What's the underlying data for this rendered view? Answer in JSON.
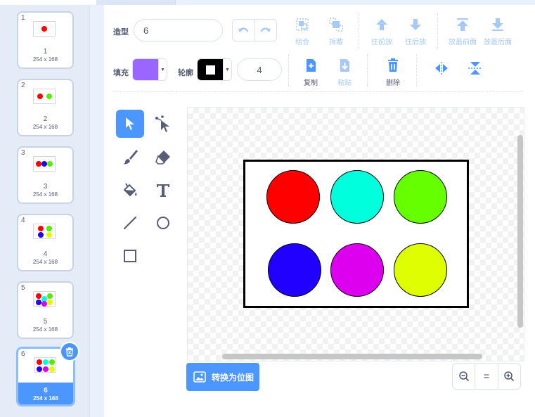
{
  "costumes": [
    {
      "num": "1",
      "name": "1",
      "size": "254 x 168",
      "dots": [
        "#ff0000"
      ]
    },
    {
      "num": "2",
      "name": "2",
      "size": "254 x 168",
      "dots": [
        "#ff0000",
        "#55ee00"
      ]
    },
    {
      "num": "3",
      "name": "3",
      "size": "254 x 168",
      "dots": [
        "#ff0000",
        "#2200ee",
        "#55ee00"
      ]
    },
    {
      "num": "4",
      "name": "4",
      "size": "254 x 168",
      "dots": [
        "#ff0000",
        "#55ee00",
        "#2200ee",
        "#ddff00"
      ]
    },
    {
      "num": "5",
      "name": "5",
      "size": "254 x 168",
      "dots": [
        "#ff0000",
        "#00ffdd",
        "#55ee00",
        "#2200ee",
        "#dd00ee",
        "#ddff00"
      ]
    },
    {
      "num": "6",
      "name": "6",
      "size": "254 x 168",
      "dots": [
        "#ff0000",
        "#00ffdd",
        "#55ee00",
        "#2200ee",
        "#dd00ee",
        "#ddff00"
      ]
    }
  ],
  "toolbar": {
    "costume_label": "造型",
    "costume_name": "6",
    "group_label": "组合",
    "ungroup_label": "拆散",
    "forward_label": "往前放",
    "backward_label": "往后放",
    "front_label": "放最前面",
    "back_label": "放最后面",
    "fill_label": "填充",
    "outline_label": "轮廓",
    "outline_width": "4",
    "copy_label": "复制",
    "paste_label": "粘贴",
    "delete_label": "删除"
  },
  "colors": {
    "fill": "#9966ff",
    "outline": "#000000",
    "accent": "#4c97ff"
  },
  "canvas": {
    "circles": [
      "#ff0000",
      "#00ffdd",
      "#66ff00",
      "#2200ff",
      "#dd00ee",
      "#ddff00"
    ]
  },
  "footer": {
    "convert_label": "转换为位图",
    "zoom_out": "−",
    "zoom_reset": "=",
    "zoom_in": "+"
  }
}
